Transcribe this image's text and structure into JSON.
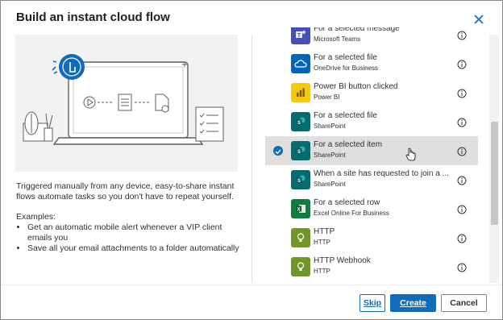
{
  "dialog": {
    "title": "Build an instant cloud flow",
    "description": "Triggered manually from any device, easy-to-share instant flows automate tasks so you don't have to repeat yourself.",
    "examples_heading": "Examples:",
    "examples": [
      "Get an automatic mobile alert whenever a VIP client emails you",
      "Save all your email attachments to a folder automatically"
    ]
  },
  "triggers": [
    {
      "title": "For a selected message",
      "connector": "Microsoft Teams",
      "icon": "teams-icon",
      "color": "#464eb8"
    },
    {
      "title": "For a selected file",
      "connector": "OneDrive for Business",
      "icon": "onedrive-icon",
      "color": "#0364b8"
    },
    {
      "title": "Power BI button clicked",
      "connector": "Power BI",
      "icon": "powerbi-icon",
      "color": "#f2c811"
    },
    {
      "title": "For a selected file",
      "connector": "SharePoint",
      "icon": "sharepoint-icon",
      "color": "#036c70"
    },
    {
      "title": "For a selected item",
      "connector": "SharePoint",
      "icon": "sharepoint-icon",
      "color": "#036c70",
      "selected": true
    },
    {
      "title": "When a site has requested to join a ...",
      "connector": "SharePoint",
      "icon": "sharepoint-icon",
      "color": "#036c70"
    },
    {
      "title": "For a selected row",
      "connector": "Excel Online For Business",
      "icon": "excel-icon",
      "color": "#107c41"
    },
    {
      "title": "HTTP",
      "connector": "HTTP",
      "icon": "http-icon",
      "color": "#709727"
    },
    {
      "title": "HTTP Webhook",
      "connector": "HTTP",
      "icon": "http-icon",
      "color": "#709727"
    }
  ],
  "footer": {
    "skip_label": "Skip",
    "create_label": "Create",
    "cancel_label": "Cancel"
  },
  "colors": {
    "accent": "#0f6cbd"
  }
}
